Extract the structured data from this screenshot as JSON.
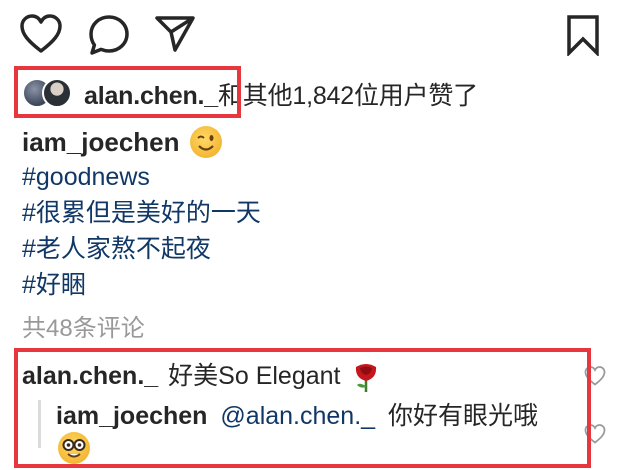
{
  "colors": {
    "accent_link": "#103766",
    "highlight_border": "#e8363f",
    "muted": "#999999"
  },
  "actions": {
    "like_icon": "heart-outline-icon",
    "comment_icon": "comment-bubble-icon",
    "share_icon": "paper-plane-icon",
    "save_icon": "bookmark-outline-icon"
  },
  "likes": {
    "username": "alan.chen._",
    "text": "和其他1,842位用户赞了"
  },
  "post": {
    "username": "iam_joechen",
    "emoji": "winking-face-icon",
    "hashtags": [
      "#goodnews",
      "#很累但是美好的一天",
      "#老人家熬不起夜",
      "#好睏"
    ]
  },
  "comments": {
    "count_label": "共48条评论",
    "items": [
      {
        "username": "alan.chen._",
        "text": "好美So Elegant",
        "emoji": "rose-icon"
      },
      {
        "username": "iam_joechen",
        "mention": "@alan.chen._",
        "text": "你好有眼光哦",
        "emoji": "nerd-face-icon"
      }
    ]
  }
}
